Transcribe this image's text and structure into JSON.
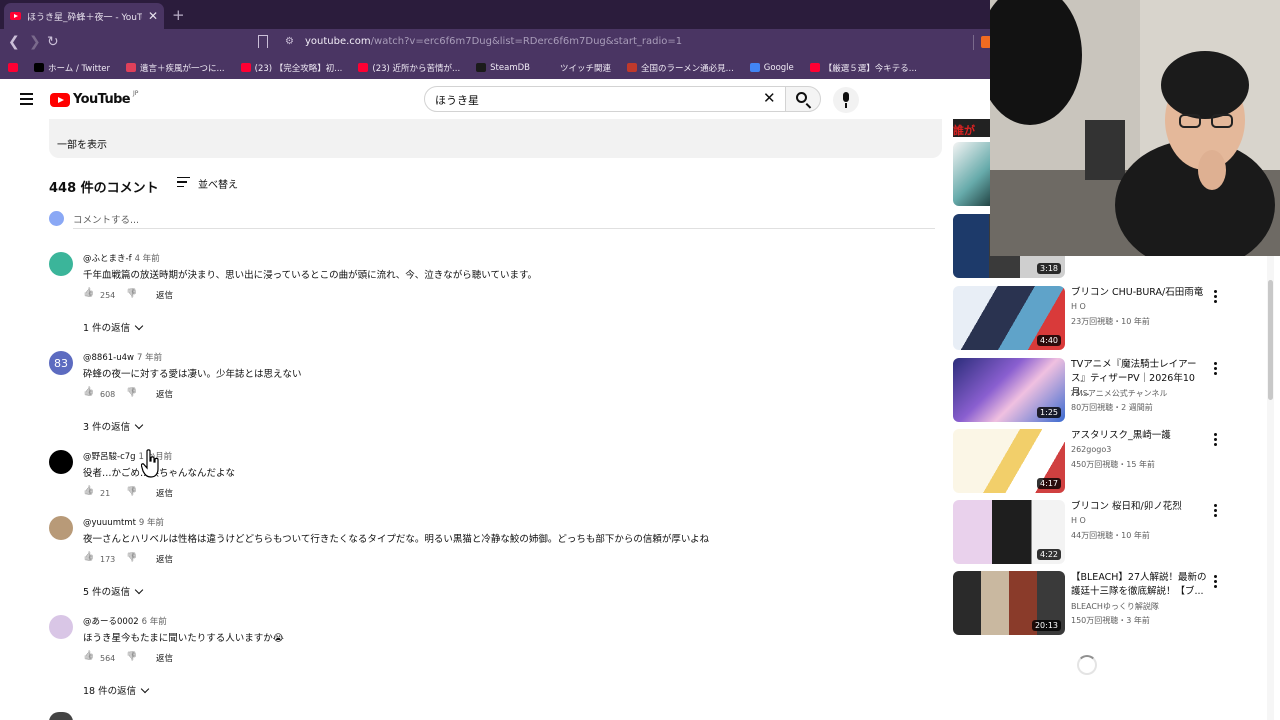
{
  "browser": {
    "tab_title": "ほうき星_砕蜂＋夜一 - YouTube",
    "url_host": "youtube.com",
    "url_path": "/watch?v=erc6f6m7Dug&list=RDerc6f6m7Dug&start_radio=1",
    "bookmarks": [
      {
        "label": "",
        "icon": "youtube-icon",
        "color": "#ff0033"
      },
      {
        "label": "ホーム / Twitter",
        "icon": "x-icon",
        "color": "#000000"
      },
      {
        "label": "遺言＋疾風が一つに...",
        "icon": "bookmark-icon",
        "color": "#e0405a"
      },
      {
        "label": "(23) 【完全攻略】初...",
        "icon": "youtube-icon",
        "color": "#ff0033"
      },
      {
        "label": "(23) 近所から苦情が...",
        "icon": "youtube-icon",
        "color": "#ff0033"
      },
      {
        "label": "SteamDB",
        "icon": "steamdb-icon",
        "color": "#1b1b1b"
      },
      {
        "label": "ツイッチ関連",
        "icon": "folder-icon",
        "color": "#4a3563"
      },
      {
        "label": "全国のラーメン通必見...",
        "icon": "ramen-icon",
        "color": "#c0392b"
      },
      {
        "label": "Google",
        "icon": "google-icon",
        "color": "#4285f4"
      },
      {
        "label": "【厳選５選】今キテる...",
        "icon": "youtube-icon",
        "color": "#ff0033"
      }
    ]
  },
  "youtube": {
    "logo_text": "YouTube",
    "country": "JP",
    "search_value": "ほうき星"
  },
  "description": {
    "show_more": "一部を表示"
  },
  "comments_section": {
    "count_label": "448 件のコメント",
    "sort_label": "並べ替え",
    "add_comment_placeholder": "コメントする...",
    "reply_label": "返信",
    "comments": [
      {
        "author": "@ふとまき-f",
        "time": "4 年前",
        "text": "千年血戦篇の放送時期が決まり、思い出に浸っているとこの曲が頭に流れ、今、泣きながら聴いています。",
        "likes": "254",
        "replies": "1 件の返信",
        "avatar_color": "#3bb59a",
        "avatar_text": ""
      },
      {
        "author": "@8861-u4w",
        "time": "7 年前",
        "text": "砕蜂の夜一に対する愛は凄い。少年誌とは思えない",
        "likes": "608",
        "replies": "3 件の返信",
        "avatar_color": "#5c6bc0",
        "avatar_text": "83"
      },
      {
        "author": "@野呂駿-c7g",
        "time": "1 か月前",
        "text": "役者…かごめ…浜ちゃんなんだよな",
        "likes": "21",
        "replies": "",
        "avatar_color": "#000000",
        "avatar_text": ""
      },
      {
        "author": "@yuuumtmt",
        "time": "9 年前",
        "text": "夜一さんとハリベルは性格は違うけどどちらもついて行きたくなるタイプだな。明るい黒猫と冷静な鮫の姉御。どっちも部下からの信頼が厚いよね",
        "likes": "173",
        "replies": "5 件の返信",
        "avatar_color": "#b89a78",
        "avatar_text": ""
      },
      {
        "author": "@あーる0002",
        "time": "6 年前",
        "text": "ほうき星今もたまに聞いたりする人いますか😭",
        "likes": "564",
        "replies": "18 件の返信",
        "avatar_color": "#d9c6e6",
        "avatar_text": ""
      }
    ]
  },
  "sidebar": {
    "clipped_title": "誰が",
    "partial_duration": "3:18",
    "recommendations": [
      {
        "title": "ブリコン CHU-BURA/石田雨竜",
        "channel": "H O",
        "meta": "23万回視聴・10 年前",
        "duration": "4:40",
        "thumb_color": "#d8dde8"
      },
      {
        "title": "TVアニメ『魔法騎士レイアース』ティザーPV｜2026年10月...",
        "channel": "TMSアニメ公式チャンネル",
        "meta": "80万回視聴・2 週間前",
        "duration": "1:25",
        "thumb_color": "#5a4fb0"
      },
      {
        "title": "アスタリスク_黒崎一護",
        "channel": "262gogo3",
        "meta": "450万回視聴・15 年前",
        "duration": "4:17",
        "thumb_color": "#f0e6c0"
      },
      {
        "title": "ブリコン 桜日和/卯ノ花烈",
        "channel": "H O",
        "meta": "44万回視聴・10 年前",
        "duration": "4:22",
        "thumb_color": "#e8d2ea"
      },
      {
        "title": "【BLEACH】27人解説！最新の護廷十三隊を徹底解説！【ブ...",
        "channel": "BLEACHゆっくり解説隊",
        "meta": "150万回視聴・3 年前",
        "duration": "20:13",
        "thumb_color": "#c9b8a0"
      }
    ]
  }
}
